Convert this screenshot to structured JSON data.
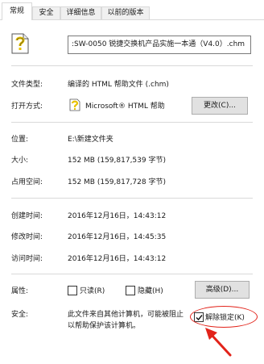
{
  "tabs": [
    {
      "label": "常规"
    },
    {
      "label": "安全"
    },
    {
      "label": "详细信息"
    },
    {
      "label": "以前的版本"
    }
  ],
  "file": {
    "name": ":SW-0050 锐捷交换机产品实施一本通（V4.0）.chm"
  },
  "props": {
    "type_label": "文件类型:",
    "type_value": "编译的 HTML 帮助文件 (.chm)",
    "open_label": "打开方式:",
    "open_value": "Microsoft® HTML 帮助",
    "change_button": "更改(C)...",
    "location_label": "位置:",
    "location_value": "E:\\新建文件夹",
    "size_label": "大小:",
    "size_value": "152 MB (159,817,539 字节)",
    "disk_label": "占用空间:",
    "disk_value": "152 MB (159,817,728 字节)",
    "created_label": "创建时间:",
    "created_value": "2016年12月16日，14:43:12",
    "modified_label": "修改时间:",
    "modified_value": "2016年12月16日，14:45:35",
    "accessed_label": "访问时间:",
    "accessed_value": "2016年12月16日，14:43:12",
    "attr_label": "属性:",
    "readonly_label": "只读(R)",
    "hidden_label": "隐藏(H)",
    "advanced_button": "高级(D)...",
    "security_label": "安全:",
    "security_text_1": "此文件来自其他计算机，可能被阻止",
    "security_text_2": "以帮助保护该计算机。",
    "unblock_label": "解除锁定(K)"
  },
  "state": {
    "readonly_checked": false,
    "hidden_checked": false,
    "unblock_checked": true
  },
  "colors": {
    "annotation": "#e2231a"
  },
  "icons": {
    "file": "chm-help-file-icon",
    "open_with": "html-help-app-icon",
    "arrow": "red-arrow-annotation"
  }
}
